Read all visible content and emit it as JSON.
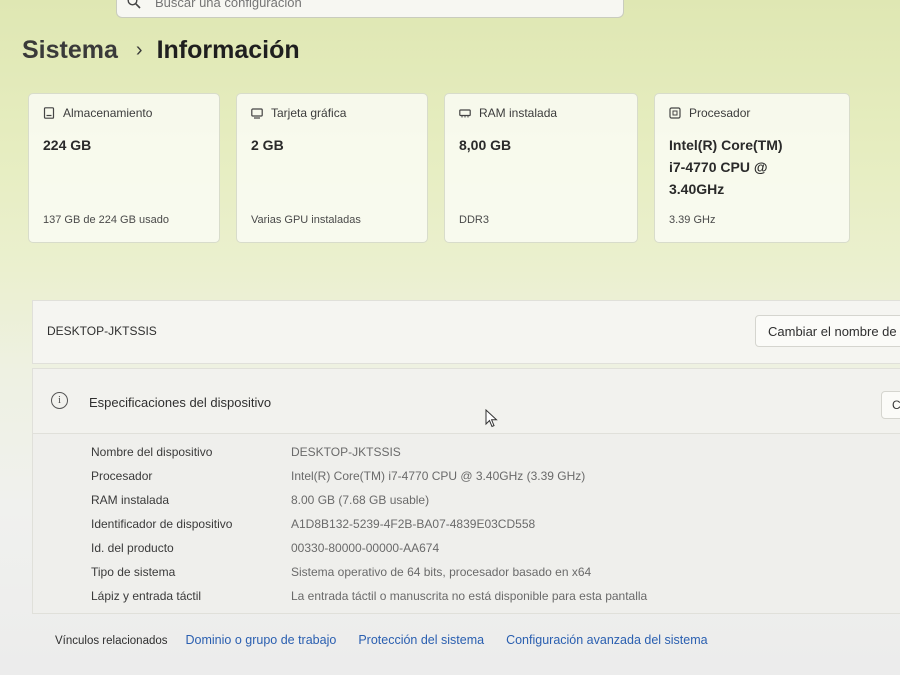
{
  "search": {
    "placeholder": "Buscar una configuración"
  },
  "breadcrumb": {
    "parent": "Sistema",
    "separator": "›",
    "current": "Información"
  },
  "cards": [
    {
      "icon": "storage-icon",
      "label": "Almacenamiento",
      "value": "224 GB",
      "sub": "137 GB de 224 GB usado"
    },
    {
      "icon": "gpu-icon",
      "label": "Tarjeta gráfica",
      "value": "2 GB",
      "sub": "Varias GPU instaladas"
    },
    {
      "icon": "ram-icon",
      "label": "RAM instalada",
      "value": "8,00 GB",
      "sub": "DDR3"
    },
    {
      "icon": "processor-icon",
      "label": "Procesador",
      "value_lines": [
        "Intel(R) Core(TM)",
        "i7-4770 CPU @",
        "3.40GHz"
      ],
      "sub": "3.39 GHz"
    }
  ],
  "device": {
    "name": "DESKTOP-JKTSSIS",
    "rename_label": "Cambiar el nombre de"
  },
  "specs": {
    "title": "Especificaciones del dispositivo",
    "copy_label": "C",
    "rows": [
      {
        "key": "Nombre del dispositivo",
        "value": "DESKTOP-JKTSSIS"
      },
      {
        "key": "Procesador",
        "value": "Intel(R) Core(TM) i7-4770 CPU @ 3.40GHz (3.39 GHz)"
      },
      {
        "key": "RAM instalada",
        "value": "8.00 GB (7.68 GB usable)"
      },
      {
        "key": "Identificador de dispositivo",
        "value": "A1D8B132-5239-4F2B-BA07-4839E03CD558"
      },
      {
        "key": "Id. del producto",
        "value": "00330-80000-00000-AA674"
      },
      {
        "key": "Tipo de sistema",
        "value": "Sistema operativo de 64 bits, procesador basado en x64"
      },
      {
        "key": "Lápiz y entrada táctil",
        "value": "La entrada táctil o manuscrita no está disponible para esta pantalla"
      }
    ]
  },
  "related": {
    "label": "Vínculos relacionados",
    "links": [
      "Dominio o grupo de trabajo",
      "Protección del sistema",
      "Configuración avanzada del sistema"
    ]
  },
  "colors": {
    "link": "#2a5fb0",
    "background_tint": "#e6edc0"
  }
}
